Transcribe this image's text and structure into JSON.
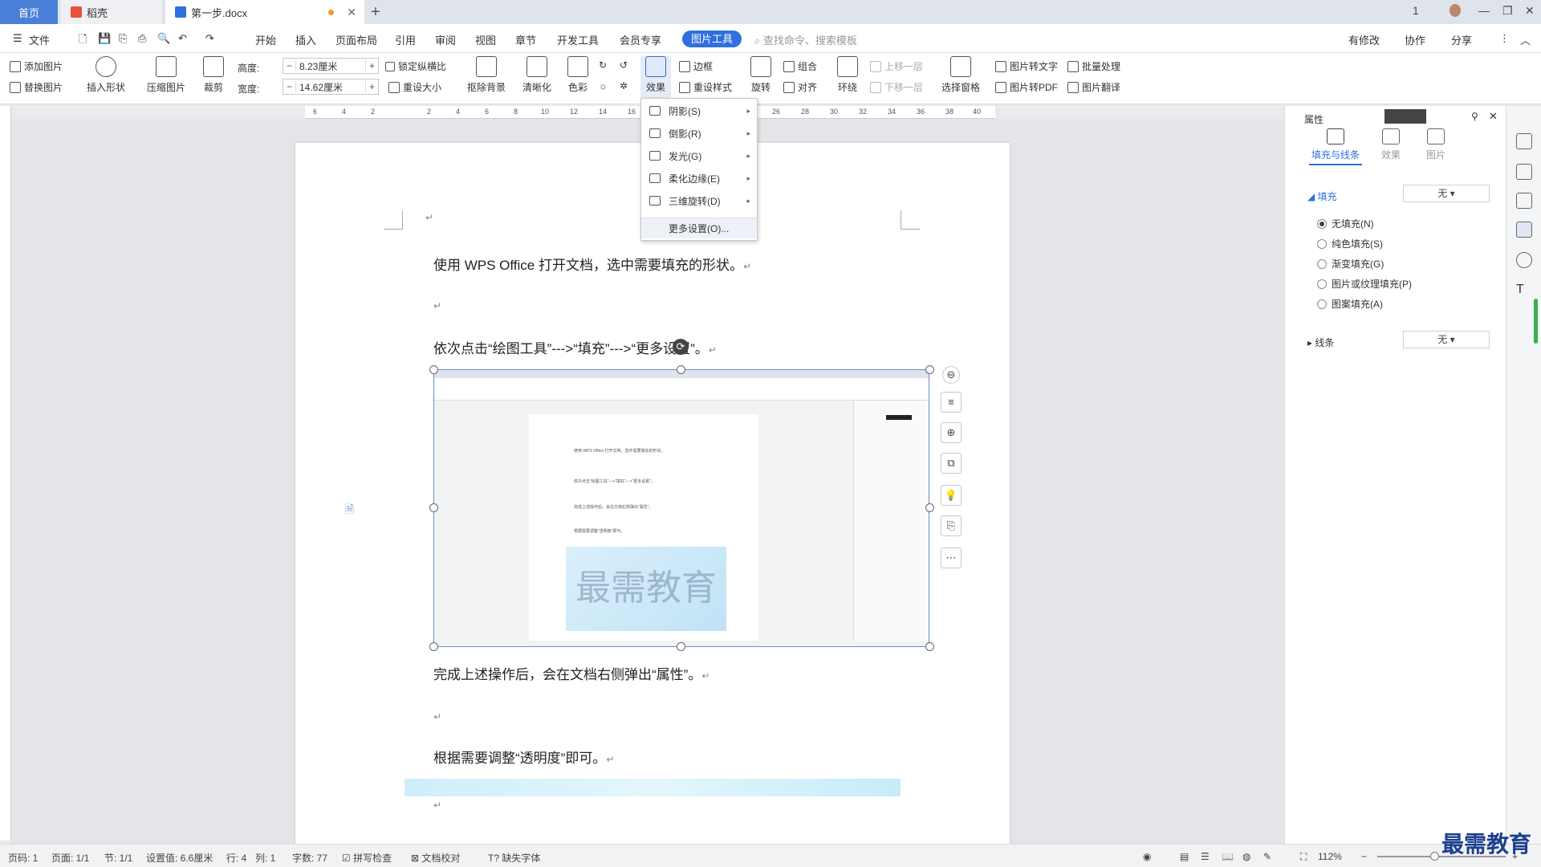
{
  "tabs": {
    "home": "首页",
    "daoke": "稻壳",
    "doc": "第一步.docx",
    "new_tab": "+"
  },
  "window_controls": {
    "minimize": "—",
    "restore": "❐",
    "close": "✕",
    "box": "1"
  },
  "menu": {
    "file": "文件",
    "items": [
      "开始",
      "插入",
      "页面布局",
      "引用",
      "审阅",
      "视图",
      "章节",
      "开发工具",
      "会员专享"
    ],
    "active": "图片工具",
    "search_placeholder": "查找命令、搜索模板",
    "right": {
      "changes": "有修改",
      "collab": "协作",
      "share": "分享"
    }
  },
  "ribbon": {
    "add_picture": "添加图片",
    "replace_picture": "替换图片",
    "insert_shape": "插入形状",
    "compress": "压缩图片",
    "crop": "裁剪",
    "height_label": "高度:",
    "height_value": "8.23厘米",
    "width_label": "宽度:",
    "width_value": "14.62厘米",
    "lock_ratio": "锁定纵横比",
    "reset_size": "重设大小",
    "remove_bg": "抠除背景",
    "sharpen": "清晰化",
    "color": "色彩",
    "effect": "效果",
    "border": "边框",
    "reset_style": "重设样式",
    "rotate": "旋转",
    "group": "组合",
    "align": "对齐",
    "wrap": "环绕",
    "bring_forward": "上移一层",
    "send_backward": "下移一层",
    "selection_pane": "选择窗格",
    "to_text": "图片转文字",
    "to_pdf": "图片转PDF",
    "batch": "批量处理",
    "translate": "图片翻译"
  },
  "ruler_ticks": [
    "6",
    "4",
    "2",
    "2",
    "4",
    "6",
    "8",
    "10",
    "12",
    "14",
    "16",
    "18",
    "20",
    "22",
    "24",
    "26",
    "28",
    "30",
    "32",
    "34",
    "36",
    "38",
    "40"
  ],
  "effect_menu": {
    "items": [
      {
        "label": "阴影(S)"
      },
      {
        "label": "倒影(R)"
      },
      {
        "label": "发光(G)"
      },
      {
        "label": "柔化边缘(E)"
      },
      {
        "label": "三维旋转(D)"
      }
    ],
    "more": "更多设置(O)..."
  },
  "document": {
    "line1": "使用 WPS Office 打开文档，选中需要填充的形状。",
    "line2": "依次点击“绘图工具”--->“填充”--->“更多设置”。",
    "line3": "完成上述操作后，会在文档右侧弹出“属性”。",
    "line4": "根据需要调整“透明度”即可。",
    "para_mark": "↵"
  },
  "picture": {
    "mini_title": "最需教育",
    "mini_lines": [
      "使用 WPS Office 打开文档，选中需要填充的形状。",
      "依次点击“绘图工具”--->“填充”--->“更多设置”。",
      "完成上述操作后，会在文档右侧弹出“属性”。",
      "根据需要调整“透明度”即可。"
    ]
  },
  "float_toolbar": [
    "⊖",
    "≡",
    "⊕",
    "⧉",
    "💡",
    "⎘",
    "⋯"
  ],
  "panel": {
    "title": "属性",
    "tabs": [
      "填充与线条",
      "效果",
      "图片"
    ],
    "fill_label": "填充",
    "fill_value": "无",
    "options": [
      "无填充(N)",
      "纯色填充(S)",
      "渐变填充(G)",
      "图片或纹理填充(P)",
      "图案填充(A)"
    ],
    "line_label": "线条",
    "line_value": "无"
  },
  "status": {
    "page_code": "页码: 1",
    "pages": "页面: 1/1",
    "section": "节: 1/1",
    "setting": "设置值: 6.6厘米",
    "row": "行: 4",
    "col": "列: 1",
    "words": "字数: 77",
    "spell": "拼写检查",
    "proof": "文档校对",
    "missing_font": "缺失字体",
    "zoom": "112%"
  },
  "corner_watermark": "最需教育",
  "colors": {
    "accent": "#2f6fe0",
    "tab_home": "#4a7fd8"
  }
}
